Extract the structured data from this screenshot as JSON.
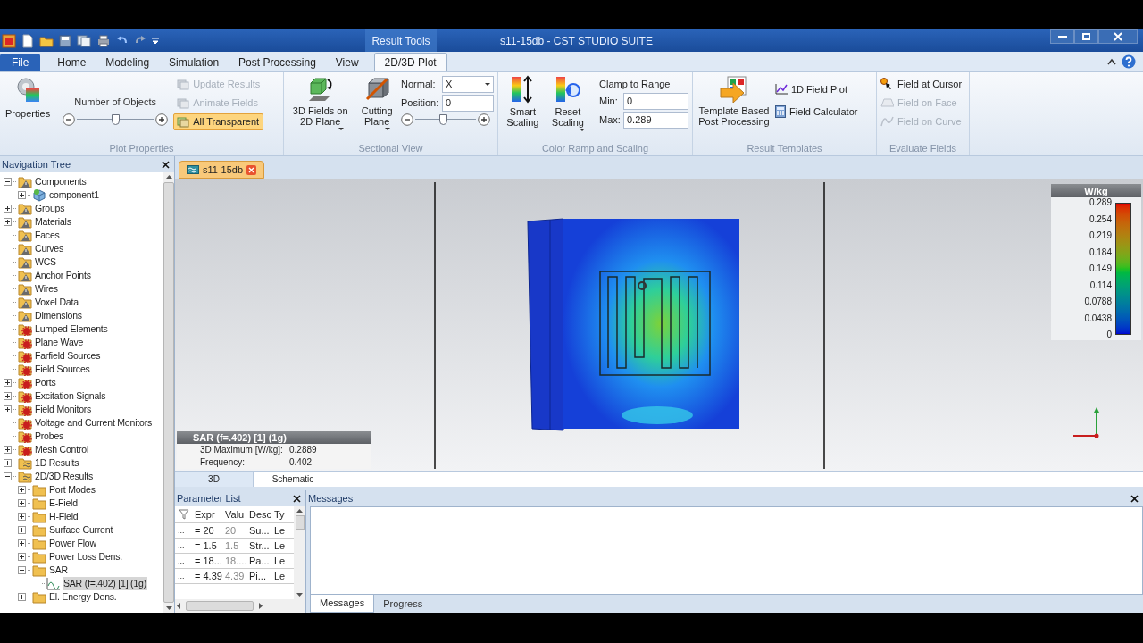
{
  "titlebar": {
    "context_tab": "Result Tools",
    "title": "s11-15db - CST STUDIO SUITE"
  },
  "tabs": [
    {
      "label": "File",
      "kind": "file",
      "selected": false
    },
    {
      "label": "Home",
      "kind": "tab",
      "selected": false
    },
    {
      "label": "Modeling",
      "kind": "tab",
      "selected": false
    },
    {
      "label": "Simulation",
      "kind": "tab",
      "selected": false
    },
    {
      "label": "Post Processing",
      "kind": "tab",
      "selected": false
    },
    {
      "label": "View",
      "kind": "tab",
      "selected": false
    },
    {
      "label": "2D/3D Plot",
      "kind": "tab",
      "selected": true
    }
  ],
  "ribbon": {
    "plot_properties": {
      "label": "Plot Properties",
      "properties": "Properties",
      "objects_label": "Number of Objects",
      "objects_slider": {
        "level": 0.5
      },
      "toggles": [
        {
          "label": "Update Results",
          "disabled": true,
          "selected": false
        },
        {
          "label": "Animate Fields",
          "disabled": true,
          "selected": false
        },
        {
          "label": "All Transparent",
          "disabled": false,
          "selected": true
        }
      ]
    },
    "sectional_view": {
      "label": "Sectional View",
      "fields_button": "3D Fields on 2D Plane",
      "cutting_button": "Cutting Plane",
      "normal_label": "Normal:",
      "normal_value": "X",
      "position_label": "Position:",
      "position_value": "0",
      "position_slider": {
        "level": 0.45
      }
    },
    "color_ramp": {
      "label": "Color Ramp and Scaling",
      "smart": "Smart Scaling",
      "reset": "Reset Scaling",
      "clamp_label": "Clamp to Range",
      "min_label": "Min:",
      "min_value": "0",
      "max_label": "Max:",
      "max_value": "0.289"
    },
    "result_templates": {
      "label": "Result Templates",
      "template": "Template Based Post Processing",
      "field_plot": "1D Field Plot",
      "calculator": "Field Calculator"
    },
    "evaluate_fields": {
      "label": "Evaluate Fields",
      "items": [
        {
          "label": "Field at Cursor",
          "disabled": false
        },
        {
          "label": "Field on Face",
          "disabled": true
        },
        {
          "label": "Field on Curve",
          "disabled": true
        }
      ]
    }
  },
  "navigation_tree": {
    "title": "Navigation Tree",
    "items": [
      {
        "label": "Components",
        "kind": "warning-folder",
        "expanded": true,
        "selected": false,
        "children": [
          {
            "label": "component1",
            "kind": "component",
            "expanded": false,
            "selected": false
          }
        ]
      },
      {
        "label": "Groups",
        "kind": "warning-folder",
        "expanded": false,
        "selected": false
      },
      {
        "label": "Materials",
        "kind": "warning-folder",
        "expanded": false,
        "selected": false
      },
      {
        "label": "Faces",
        "kind": "warning-folder",
        "selected": false
      },
      {
        "label": "Curves",
        "kind": "warning-folder",
        "selected": false
      },
      {
        "label": "WCS",
        "kind": "warning-folder",
        "selected": false
      },
      {
        "label": "Anchor Points",
        "kind": "warning-folder",
        "selected": false
      },
      {
        "label": "Wires",
        "kind": "warning-folder",
        "selected": false
      },
      {
        "label": "Voxel Data",
        "kind": "warning-folder",
        "selected": false
      },
      {
        "label": "Dimensions",
        "kind": "warning-folder",
        "selected": false
      },
      {
        "label": "Lumped Elements",
        "kind": "gear-folder",
        "selected": false
      },
      {
        "label": "Plane Wave",
        "kind": "gear-folder",
        "selected": false
      },
      {
        "label": "Farfield Sources",
        "kind": "gear-folder",
        "selected": false
      },
      {
        "label": "Field Sources",
        "kind": "gear-folder",
        "selected": false
      },
      {
        "label": "Ports",
        "kind": "gear-folder",
        "expanded": false,
        "selected": false
      },
      {
        "label": "Excitation Signals",
        "kind": "gear-folder",
        "expanded": false,
        "selected": false
      },
      {
        "label": "Field Monitors",
        "kind": "gear-folder",
        "expanded": false,
        "selected": false
      },
      {
        "label": "Voltage and Current Monitors",
        "kind": "gear-folder",
        "selected": false
      },
      {
        "label": "Probes",
        "kind": "gear-folder",
        "selected": false
      },
      {
        "label": "Mesh Control",
        "kind": "gear-folder",
        "expanded": false,
        "selected": false
      },
      {
        "label": "1D Results",
        "kind": "results-folder",
        "expanded": false,
        "selected": false
      },
      {
        "label": "2D/3D Results",
        "kind": "results-folder",
        "expanded": true,
        "selected": false,
        "children": [
          {
            "label": "Port Modes",
            "kind": "folder",
            "expanded": false,
            "selected": false
          },
          {
            "label": "E-Field",
            "kind": "folder",
            "expanded": false,
            "selected": false
          },
          {
            "label": "H-Field",
            "kind": "folder",
            "expanded": false,
            "selected": false
          },
          {
            "label": "Surface Current",
            "kind": "folder",
            "expanded": false,
            "selected": false
          },
          {
            "label": "Power Flow",
            "kind": "folder",
            "expanded": false,
            "selected": false
          },
          {
            "label": "Power Loss Dens.",
            "kind": "folder",
            "expanded": false,
            "selected": false
          },
          {
            "label": "SAR",
            "kind": "folder",
            "expanded": true,
            "selected": false,
            "children": [
              {
                "label": "SAR (f=.402) [1] (1g)",
                "kind": "plot",
                "selected": true
              }
            ]
          },
          {
            "label": "El. Energy Dens.",
            "kind": "folder",
            "expanded": false,
            "selected": false
          }
        ]
      }
    ]
  },
  "document_tab": {
    "label": "s11-15db"
  },
  "legend": {
    "title": "W/kg",
    "ticks": [
      "0.289",
      "0.254",
      "0.219",
      "0.184",
      "0.149",
      "0.114",
      "0.0788",
      "0.0438",
      "0"
    ]
  },
  "info_box": {
    "title": "SAR (f=.402) [1] (1g)",
    "rows": [
      {
        "label": "3D Maximum [W/kg]:",
        "value": "0.2889"
      },
      {
        "label": "Frequency:",
        "value": "0.402"
      }
    ]
  },
  "view_tabs": [
    {
      "label": "3D",
      "selected": true
    },
    {
      "label": "Schematic",
      "selected": false
    }
  ],
  "parameter_list": {
    "title": "Parameter List",
    "columns": [
      "Expr",
      "Valu",
      "Desc",
      "Ty"
    ],
    "rows": [
      {
        "name": "...",
        "expr": "= 20",
        "value": "20",
        "desc": "Su...",
        "type": "Le"
      },
      {
        "name": "...",
        "expr": "= 1.5",
        "value": "1.5",
        "desc": "Str...",
        "type": "Le"
      },
      {
        "name": "...",
        "expr": "= 18...",
        "value": "18....",
        "desc": "Pa...",
        "type": "Le"
      },
      {
        "name": "...",
        "expr": "= 4.39",
        "value": "4.39",
        "desc": "Pi...",
        "type": "Le"
      }
    ]
  },
  "messages": {
    "title": "Messages",
    "tabs": [
      {
        "label": "Messages",
        "selected": true
      },
      {
        "label": "Progress",
        "selected": false
      }
    ]
  }
}
